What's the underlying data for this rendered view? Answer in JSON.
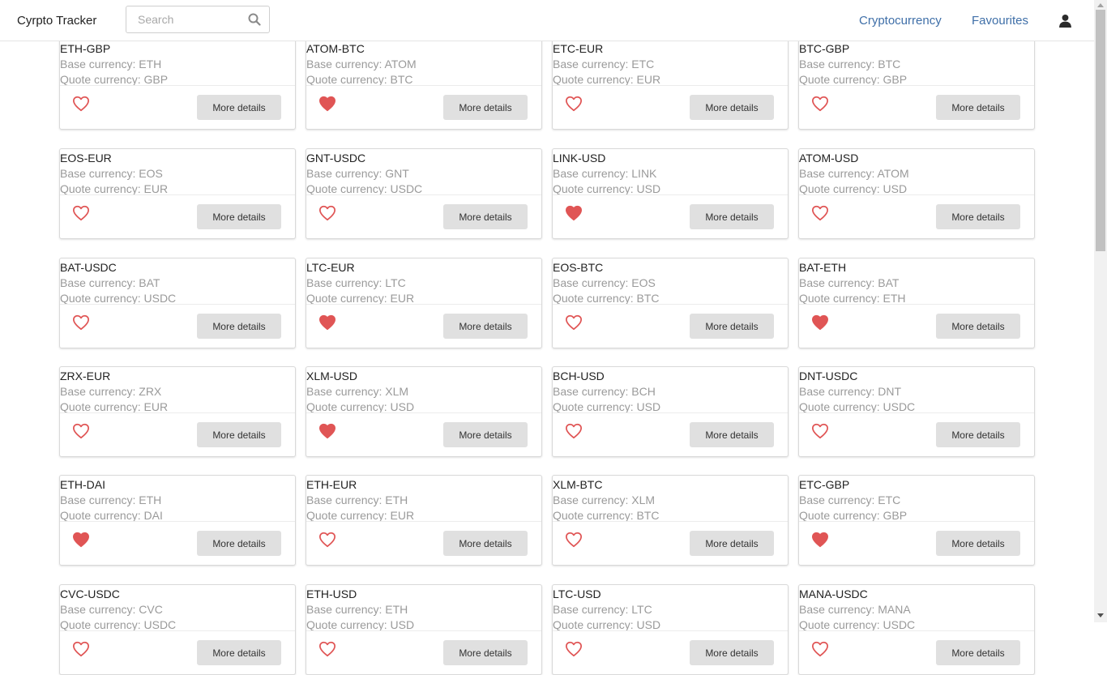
{
  "header": {
    "brand": "Cyrpto Tracker",
    "search_placeholder": "Search",
    "nav": {
      "cryptocurrency": "Cryptocurrency",
      "favourites": "Favourites"
    }
  },
  "labels": {
    "base_prefix": "Base currency: ",
    "quote_prefix": "Quote currency: ",
    "more_details": "More details"
  },
  "colors": {
    "heart": "#e05555",
    "link": "#3f6fa8"
  },
  "pairs": [
    {
      "id": "ETH-GBP",
      "base": "ETH",
      "quote": "GBP",
      "favourite": false
    },
    {
      "id": "ATOM-BTC",
      "base": "ATOM",
      "quote": "BTC",
      "favourite": true
    },
    {
      "id": "ETC-EUR",
      "base": "ETC",
      "quote": "EUR",
      "favourite": false
    },
    {
      "id": "BTC-GBP",
      "base": "BTC",
      "quote": "GBP",
      "favourite": false
    },
    {
      "id": "EOS-EUR",
      "base": "EOS",
      "quote": "EUR",
      "favourite": false
    },
    {
      "id": "GNT-USDC",
      "base": "GNT",
      "quote": "USDC",
      "favourite": false
    },
    {
      "id": "LINK-USD",
      "base": "LINK",
      "quote": "USD",
      "favourite": true
    },
    {
      "id": "ATOM-USD",
      "base": "ATOM",
      "quote": "USD",
      "favourite": false
    },
    {
      "id": "BAT-USDC",
      "base": "BAT",
      "quote": "USDC",
      "favourite": false
    },
    {
      "id": "LTC-EUR",
      "base": "LTC",
      "quote": "EUR",
      "favourite": true
    },
    {
      "id": "EOS-BTC",
      "base": "EOS",
      "quote": "BTC",
      "favourite": false
    },
    {
      "id": "BAT-ETH",
      "base": "BAT",
      "quote": "ETH",
      "favourite": true
    },
    {
      "id": "ZRX-EUR",
      "base": "ZRX",
      "quote": "EUR",
      "favourite": false
    },
    {
      "id": "XLM-USD",
      "base": "XLM",
      "quote": "USD",
      "favourite": true
    },
    {
      "id": "BCH-USD",
      "base": "BCH",
      "quote": "USD",
      "favourite": false
    },
    {
      "id": "DNT-USDC",
      "base": "DNT",
      "quote": "USDC",
      "favourite": false
    },
    {
      "id": "ETH-DAI",
      "base": "ETH",
      "quote": "DAI",
      "favourite": true
    },
    {
      "id": "ETH-EUR",
      "base": "ETH",
      "quote": "EUR",
      "favourite": false
    },
    {
      "id": "XLM-BTC",
      "base": "XLM",
      "quote": "BTC",
      "favourite": false
    },
    {
      "id": "ETC-GBP",
      "base": "ETC",
      "quote": "GBP",
      "favourite": true
    },
    {
      "id": "CVC-USDC",
      "base": "CVC",
      "quote": "USDC",
      "favourite": false
    },
    {
      "id": "ETH-USD",
      "base": "ETH",
      "quote": "USD",
      "favourite": false
    },
    {
      "id": "LTC-USD",
      "base": "LTC",
      "quote": "USD",
      "favourite": false
    },
    {
      "id": "MANA-USDC",
      "base": "MANA",
      "quote": "USDC",
      "favourite": false
    }
  ]
}
